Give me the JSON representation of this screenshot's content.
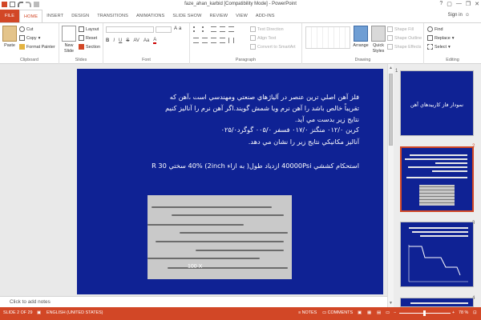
{
  "window": {
    "title": "faze_ahan_karbid [Compatibility Mode] - PowerPoint",
    "controls": [
      "?",
      "—",
      "❐",
      "✕"
    ],
    "user": "Sign in"
  },
  "tabs": [
    "FILE",
    "HOME",
    "INSERT",
    "DESIGN",
    "TRANSITIONS",
    "ANIMATIONS",
    "SLIDE SHOW",
    "REVIEW",
    "VIEW",
    "ADD-INS"
  ],
  "active_tab": "HOME",
  "ribbon": {
    "clipboard": {
      "paste": "Paste",
      "cut": "Cut",
      "copy": "Copy",
      "painter": "Format Painter",
      "label": "Clipboard"
    },
    "slides": {
      "new_slide": "New",
      "new_slide2": "Slide",
      "layout": "Layout",
      "reset": "Reset",
      "section": "Section",
      "label": "Slides"
    },
    "font": {
      "label": "Font"
    },
    "paragraph": {
      "text_direction": "Text Direction",
      "align_text": "Align Text",
      "smartart": "Convert to SmartArt",
      "label": "Paragraph"
    },
    "drawing": {
      "arrange": "Arrange",
      "quick_styles": "Quick",
      "quick_styles2": "Styles",
      "shape_fill": "Shape Fill",
      "shape_outline": "Shape Outline",
      "shape_effects": "Shape Effects",
      "label": "Drawing"
    },
    "editing": {
      "find": "Find",
      "replace": "Replace",
      "select": "Select",
      "label": "Editing"
    }
  },
  "slide": {
    "lines": [
      "فلز آهن اصلي ترين عنصر در آلياژهاي صنعتي ومهندسي است ،آهن كه",
      "تقريباً خالص باشد را آهن نرم ويا شمش گويند.اگر آهن نرم را آناليز كنيم",
      "نتايج زير بدست مي آيد.",
      "كربن ۰۱۲/۰     منگنز ۰۱۷/۰     فسفر ۰۰۵/۰     گوگرد۰۲۵/۰",
      "آناليز مكانيكي نتايج زير را نشان مي دهد.",
      "استحكام كششي 40000Psi ازدياد طول( به ازاء 2inch) 40% سختي R 30"
    ],
    "photo_label": "100 X"
  },
  "notes_placeholder": "Click to add notes",
  "thumbnails": [
    {
      "number": "1",
      "title": "نمودار فاز كاربيدهاي آهن"
    },
    {
      "number": "2",
      "title": ""
    },
    {
      "number": "3",
      "title": ""
    },
    {
      "number": "4",
      "title": ""
    }
  ],
  "status": {
    "slide": "SLIDE 2 OF 29",
    "language": "ENGLISH (UNITED STATES)",
    "notes": "NOTES",
    "comments": "COMMENTS",
    "zoom": "78 %"
  },
  "colors": {
    "accent": "#d24726",
    "slide_bg": "#0f2294"
  }
}
